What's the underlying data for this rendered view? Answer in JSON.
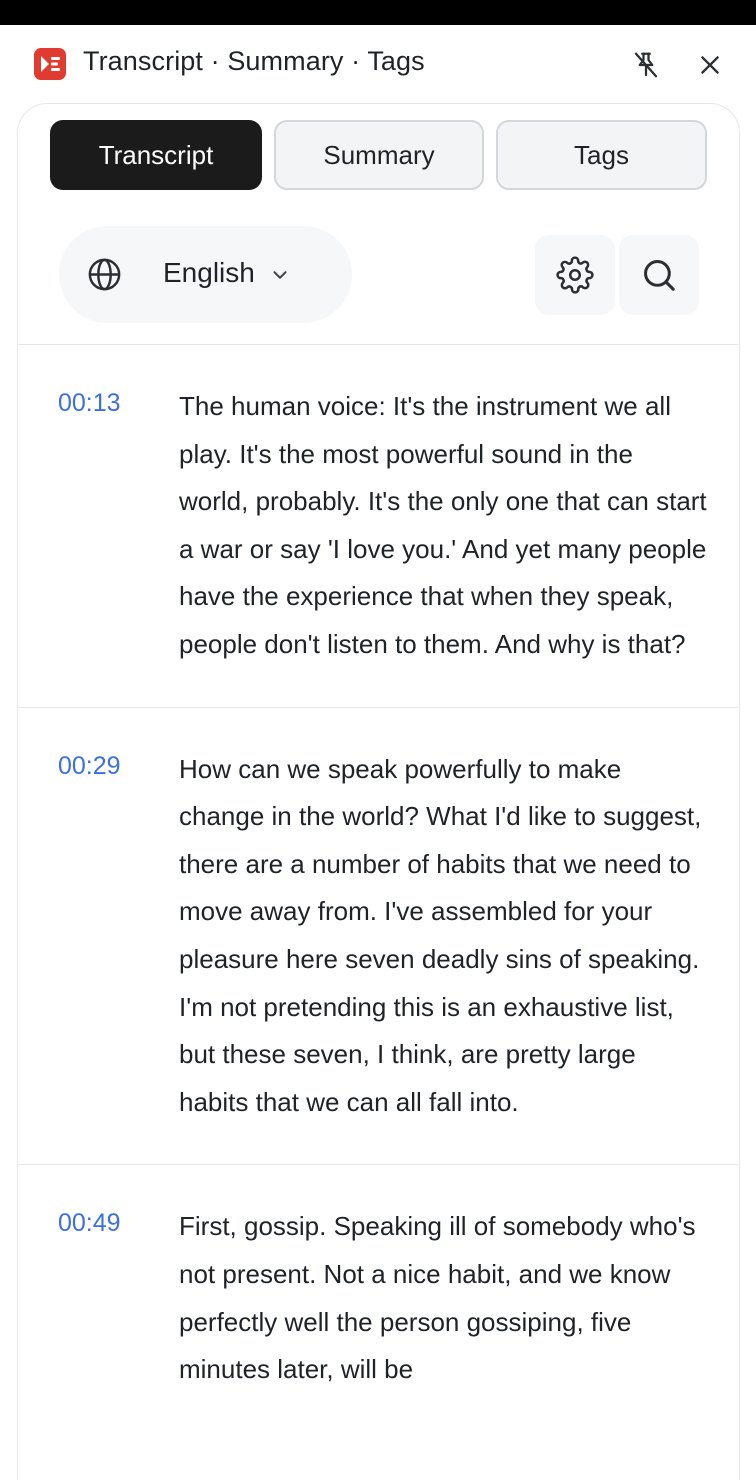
{
  "header": {
    "title": "Transcript · Summary · Tags",
    "logo_icon": "play-list-logo-icon",
    "pin_icon": "unpin-icon",
    "close_icon": "close-icon"
  },
  "tabs": [
    {
      "label": "Transcript",
      "active": true
    },
    {
      "label": "Summary",
      "active": false
    },
    {
      "label": "Tags",
      "active": false
    }
  ],
  "language": {
    "selected": "English",
    "icon": "globe-icon"
  },
  "toolbar": {
    "settings_icon": "gear-icon",
    "search_icon": "search-icon"
  },
  "transcript": [
    {
      "time": "00:13",
      "text": "The human voice: It's the instrument we all play. It's the most powerful sound in the world, probably. It's the only one that can start a war or say 'I love you.' And yet many people have the experience that when they speak, people don't listen to them. And why is that?"
    },
    {
      "time": "00:29",
      "text": "How can we speak powerfully to make change in the world? What I'd like to suggest, there are a number of habits that we need to move away from. I've assembled for your pleasure here seven deadly sins of speaking. I'm not pretending this is an exhaustive list, but these seven, I think, are pretty large habits that we can all fall into."
    },
    {
      "time": "00:49",
      "text": "First, gossip. Speaking ill of somebody who's not present. Not a nice habit, and we know perfectly well the person gossiping, five minutes later, will be"
    }
  ],
  "colors": {
    "accent": "#3d6fe0",
    "logo": "#e03b31",
    "active_tab": "#1b1b1b"
  }
}
